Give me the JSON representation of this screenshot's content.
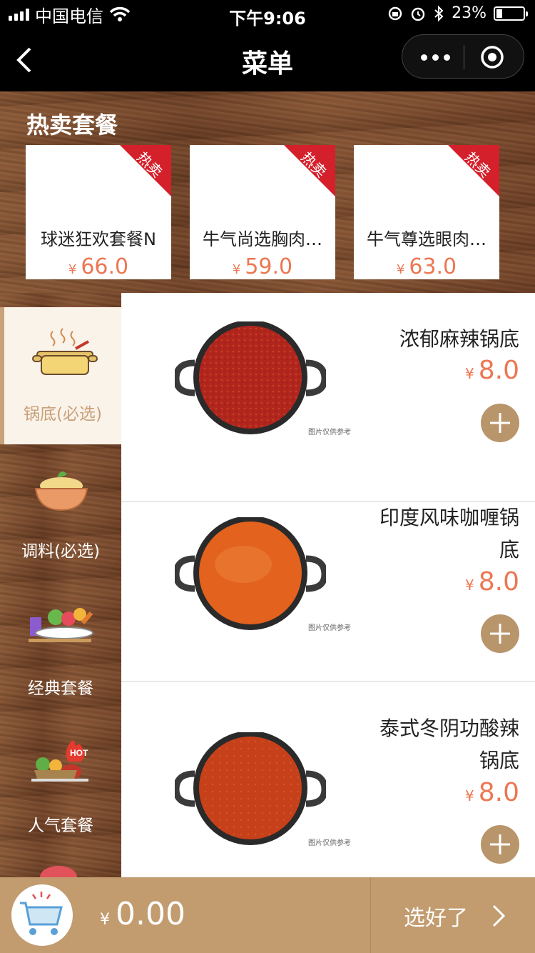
{
  "status_bar": {
    "carrier": "中国电信",
    "time": "下午9:06",
    "battery_percent": "23%",
    "battery_level": 0.23,
    "icons": [
      "signal-icon",
      "wifi-icon",
      "rotation-lock-icon",
      "alarm-icon",
      "bluetooth-icon",
      "battery-icon"
    ]
  },
  "nav": {
    "title": "菜单",
    "back_icon": "chevron-left-icon",
    "more_icon": "more-dots-icon",
    "close_icon": "target-circle-icon"
  },
  "hot_section": {
    "title": "热卖套餐",
    "items": [
      {
        "name": "球迷狂欢套餐N",
        "currency": "¥",
        "price": "66.0",
        "badge": "热卖"
      },
      {
        "name": "牛气尚选胸肉…",
        "currency": "¥",
        "price": "59.0",
        "badge": "热卖"
      },
      {
        "name": "牛气尊选眼肉…",
        "currency": "¥",
        "price": "63.0",
        "badge": "热卖"
      }
    ]
  },
  "sidebar": {
    "items": [
      {
        "label": "锅底(必选)",
        "icon": "pot-icon",
        "active": true
      },
      {
        "label": "调料(必选)",
        "icon": "seasoning-bowl-icon",
        "active": false
      },
      {
        "label": "经典套餐",
        "icon": "classic-platter-icon",
        "active": false
      },
      {
        "label": "人气套餐",
        "icon": "hot-platter-icon",
        "active": false
      }
    ]
  },
  "products": [
    {
      "name": "浓郁麻辣锅底",
      "currency": "¥",
      "price": "8.0",
      "caption": "图片仅供参考",
      "soup_color": "#b0261d"
    },
    {
      "name": "印度风味咖喱锅底",
      "currency": "¥",
      "price": "8.0",
      "caption": "图片仅供参考",
      "soup_color": "#e2621e"
    },
    {
      "name": "泰式冬阴功酸辣锅底",
      "currency": "¥",
      "price": "8.0",
      "caption": "图片仅供参考",
      "soup_color": "#c6401a"
    }
  ],
  "bottom_bar": {
    "currency": "¥",
    "total": "0.00",
    "checkout_label": "选好了",
    "cart_icon": "shopping-cart-icon",
    "arrow_icon": "chevron-right-icon"
  },
  "colors": {
    "accent_price": "#ec7752",
    "brown_accent": "#c29c6f",
    "hot_ribbon": "#d4202b",
    "active_sidebar_text": "#c9a077"
  }
}
